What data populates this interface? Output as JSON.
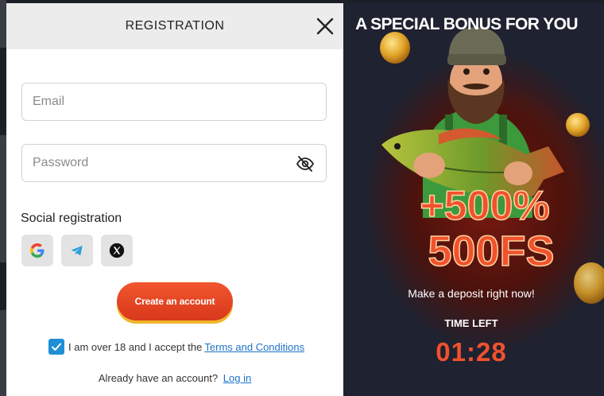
{
  "form": {
    "title": "REGISTRATION",
    "email_placeholder": "Email",
    "password_placeholder": "Password",
    "social_label": "Social registration",
    "social_buttons": [
      "google-icon",
      "telegram-icon",
      "x-icon"
    ],
    "create_button": "Create an account",
    "terms_prefix": "I am over 18 and I accept the",
    "terms_link": "Terms and Conditions",
    "terms_checked": true,
    "login_prompt": "Already have an account?",
    "login_link": "Log in"
  },
  "promo": {
    "title": "A SPECIAL BONUS FOR YOU",
    "bonus_line1": "+500%",
    "bonus_line2": "500FS",
    "deposit_text": "Make a deposit right now!",
    "time_left_label": "TIME LEFT",
    "timer": "01:28",
    "accent_color": "#f0512e"
  }
}
